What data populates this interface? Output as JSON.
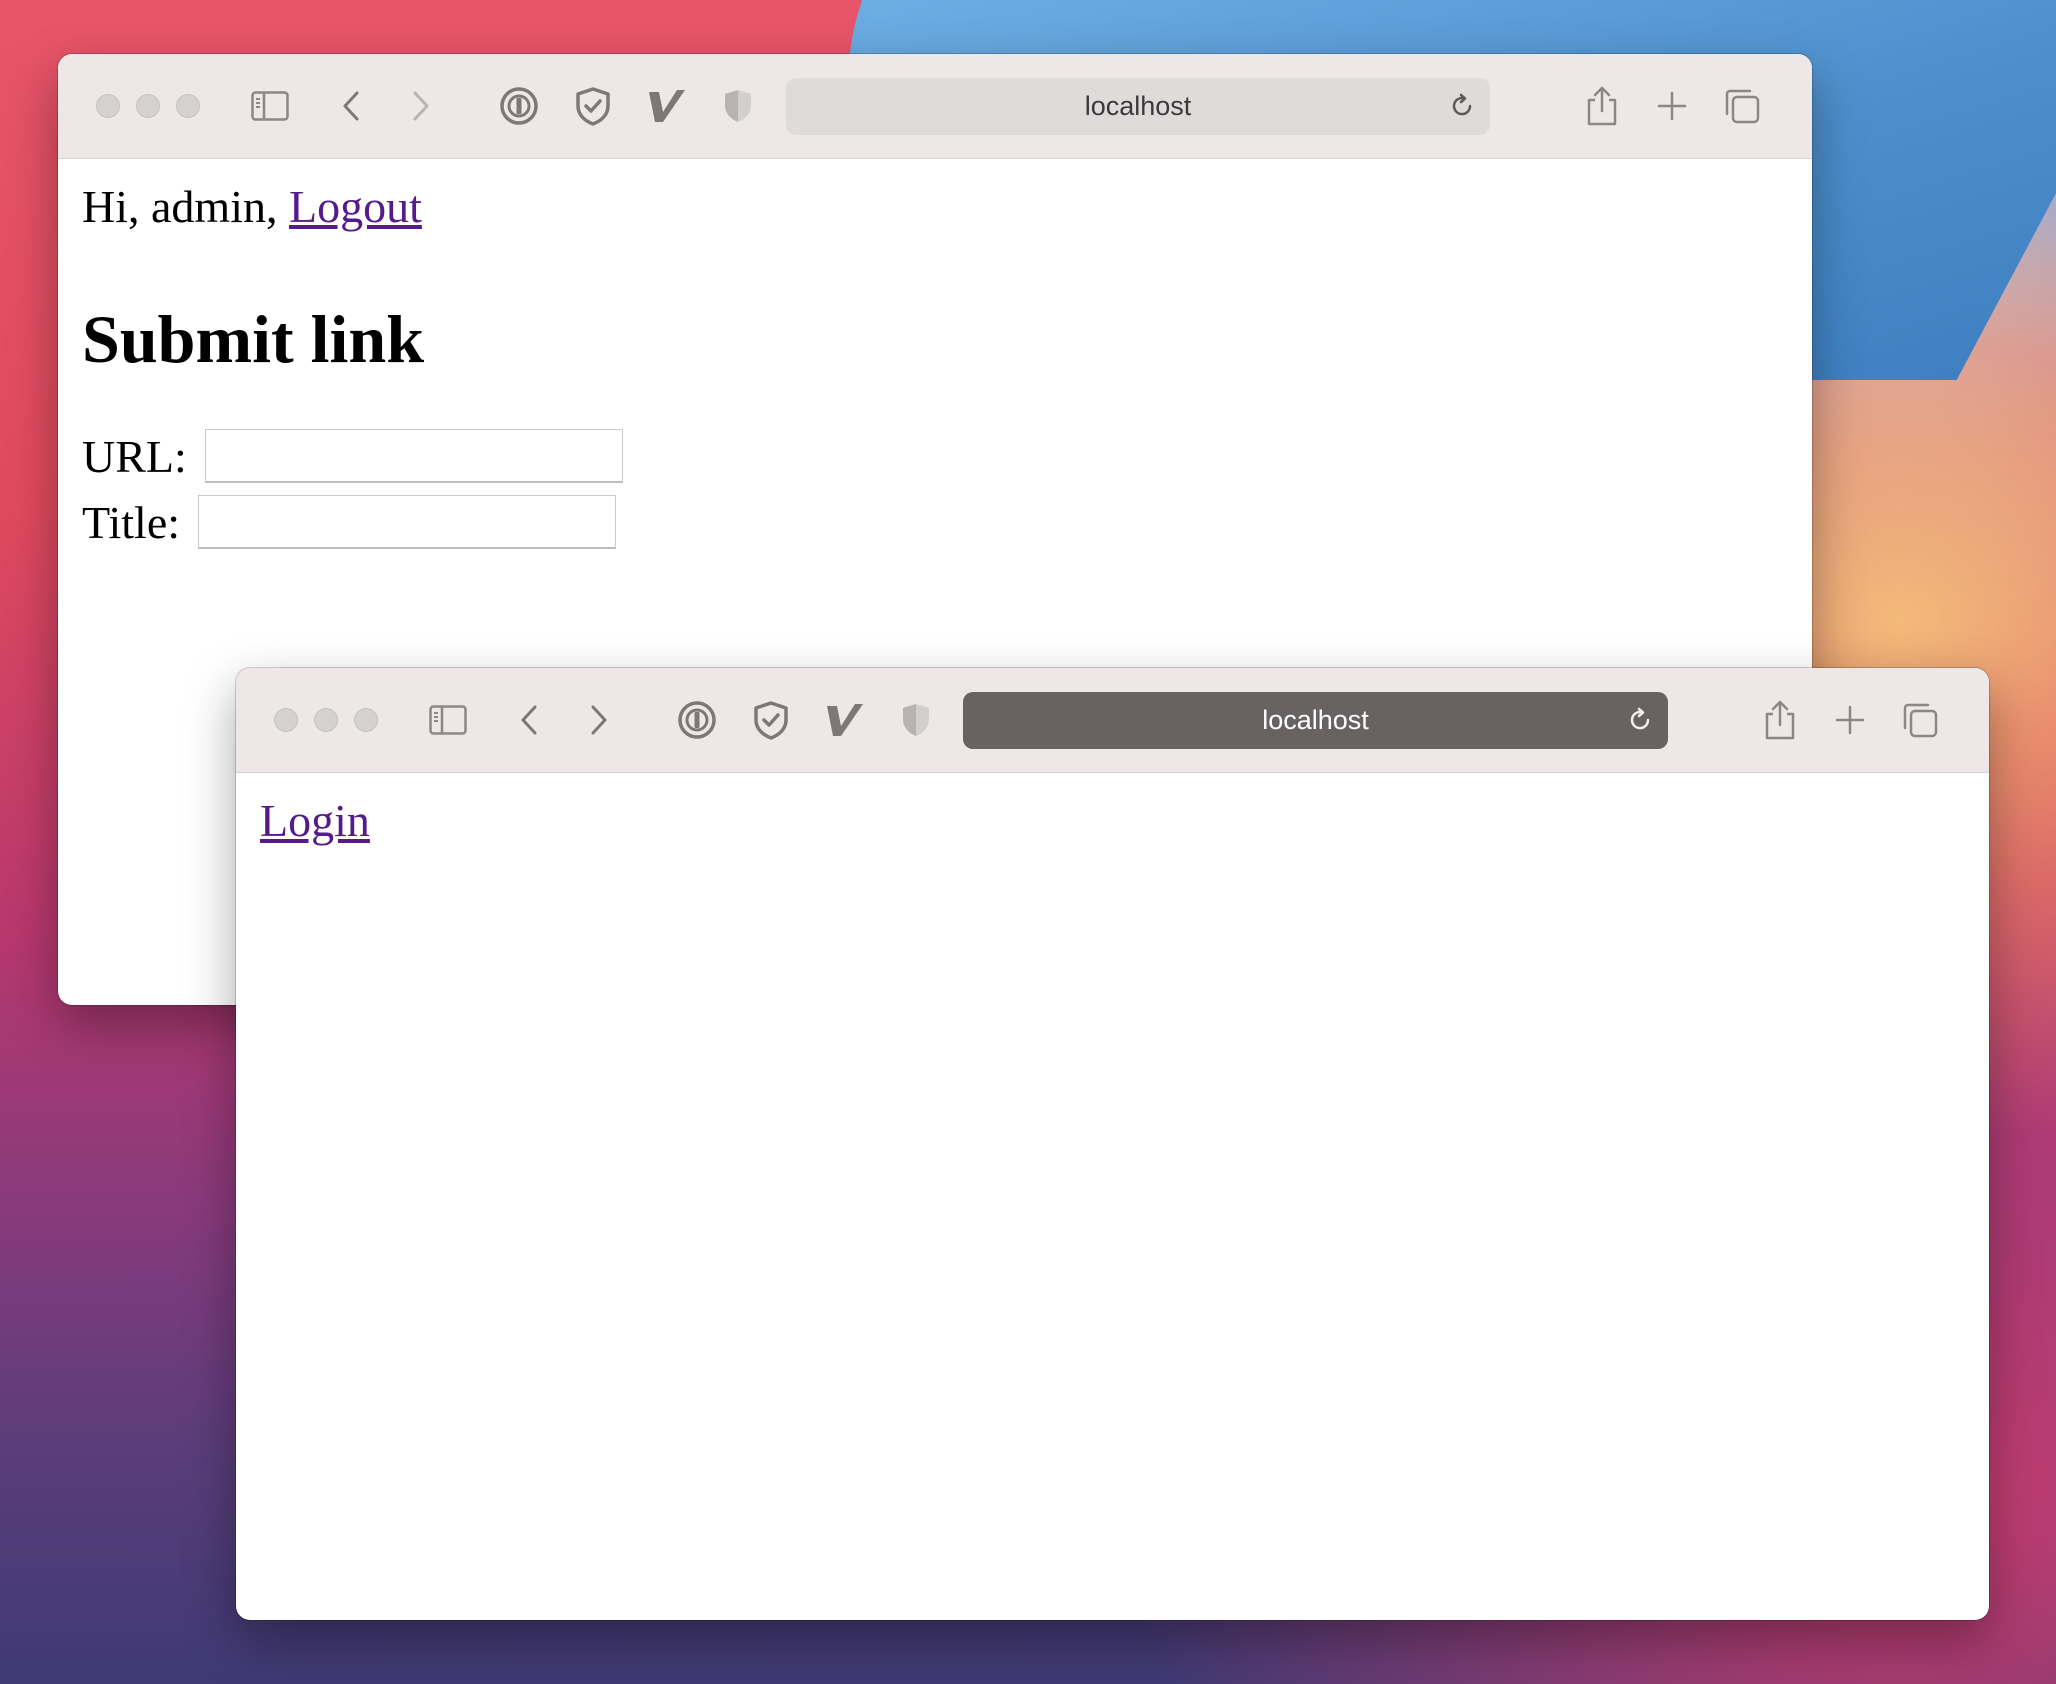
{
  "theme": {
    "toolbar_bg": "#ede7e7",
    "address_bg": "#e0dbdb",
    "address_active_bg": "#686262",
    "link_color": "#551a8b"
  },
  "back_window": {
    "address": "localhost",
    "page": {
      "greeting": "Hi, admin,",
      "logout_link": "Logout",
      "title": "Submit link",
      "fields": [
        {
          "label": "URL:",
          "value": ""
        },
        {
          "label": "Title:",
          "value": ""
        }
      ]
    }
  },
  "front_window": {
    "address": "localhost",
    "page": {
      "login_link": "Login"
    }
  },
  "toolbar_icons": [
    "sidebar-toggle-icon",
    "back-arrow-icon",
    "forward-arrow-icon",
    "password-manager-icon",
    "shield-check-icon",
    "v-extension-icon",
    "privacy-shield-icon",
    "reload-icon",
    "share-icon",
    "new-tab-icon",
    "tab-overview-icon"
  ]
}
